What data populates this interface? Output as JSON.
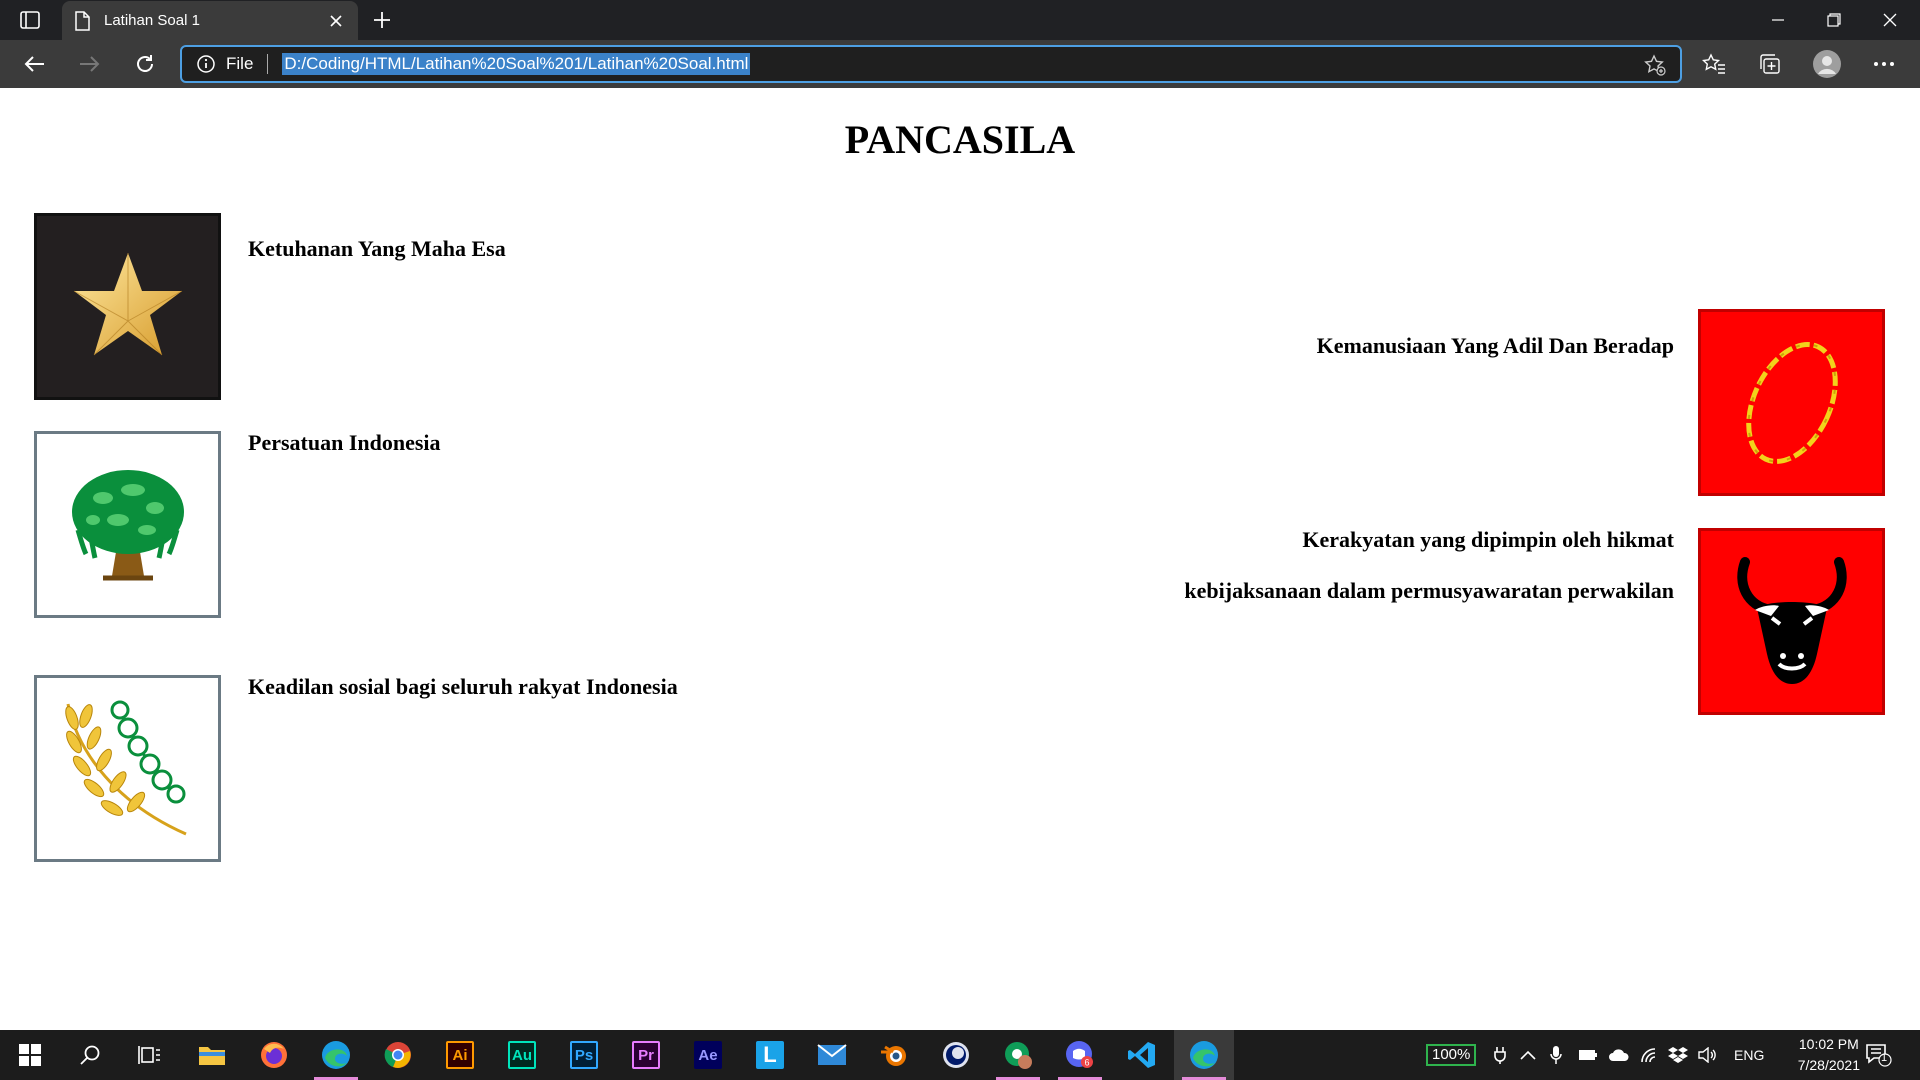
{
  "browser": {
    "tab_title": "Latihan Soal 1",
    "address_scheme_label": "File",
    "url": "D:/Coding/HTML/Latihan%20Soal%201/Latihan%20Soal.html"
  },
  "page": {
    "title": "PANCASILA",
    "sila": [
      {
        "text": "Ketuhanan Yang Maha Esa",
        "emblem": "star"
      },
      {
        "text": "Kemanusiaan Yang Adil Dan Beradap",
        "emblem": "chain"
      },
      {
        "text": "Persatuan Indonesia",
        "emblem": "banyan-tree"
      },
      {
        "line1": "Kerakyatan yang dipimpin oleh hikmat",
        "line2": "kebijaksanaan dalam permusyawaratan perwakilan",
        "emblem": "bull-head"
      },
      {
        "text": "Keadilan sosial bagi seluruh rakyat Indonesia",
        "emblem": "rice-and-cotton"
      }
    ]
  },
  "taskbar": {
    "apps": [
      "Start",
      "Search",
      "Task View",
      "File Explorer",
      "Firefox",
      "Edge",
      "Chrome",
      "Ai",
      "Au",
      "Ps",
      "Pr",
      "Ae",
      "L",
      "Mail",
      "Blender",
      "Cinema 4D",
      "Chrome Profile",
      "Discord",
      "VS Code",
      "Edge"
    ],
    "battery": "100%",
    "language": "ENG",
    "time": "10:02 PM",
    "date": "7/28/2021",
    "notification_count": "1"
  },
  "colors": {
    "tab_bg": "#202124",
    "toolbar_bg": "#3b3b3b",
    "address_border": "#4d9fe3",
    "emblem_red": "#ff0000",
    "emblem_dark": "#231f20",
    "taskbar_bg": "#1c1c1c"
  }
}
